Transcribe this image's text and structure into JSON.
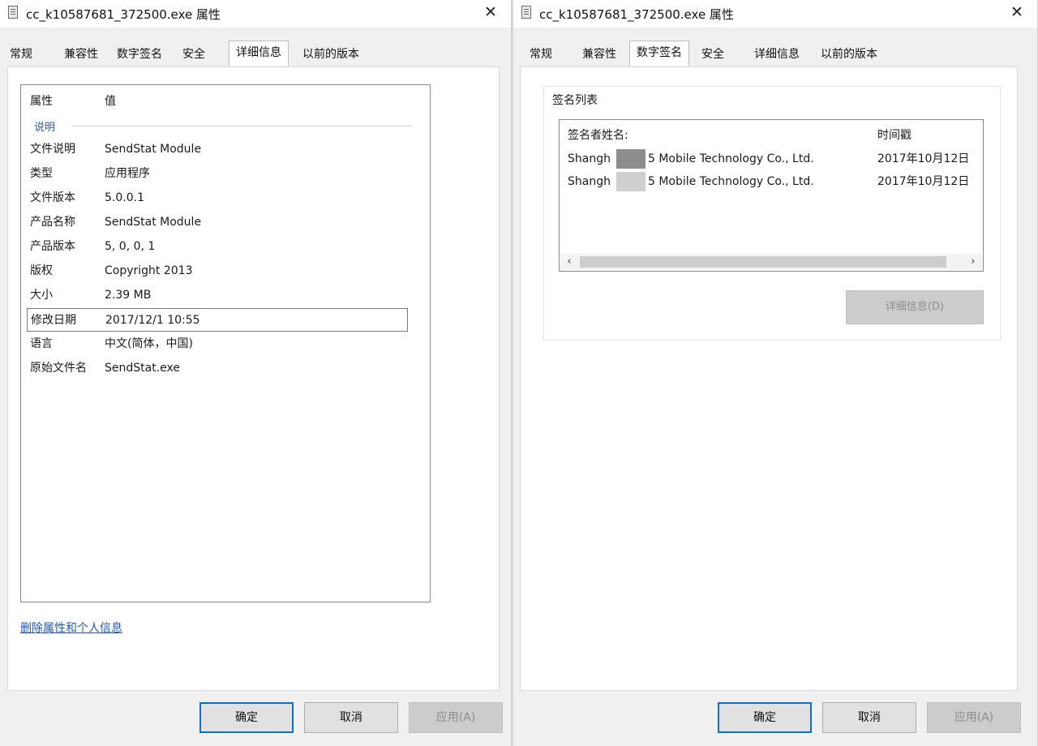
{
  "left_window": {
    "title": "cc_k10587681_372500.exe 属性",
    "tabs": [
      "常规",
      "兼容性",
      "数字签名",
      "安全",
      "详细信息",
      "以前的版本"
    ],
    "active_tab": "详细信息",
    "details": {
      "header_property": "属性",
      "header_value": "值",
      "group": "说明",
      "rows": [
        {
          "key": "文件说明",
          "value": "SendStat Module"
        },
        {
          "key": "类型",
          "value": "应用程序"
        },
        {
          "key": "文件版本",
          "value": "5.0.0.1"
        },
        {
          "key": "产品名称",
          "value": "SendStat Module"
        },
        {
          "key": "产品版本",
          "value": "5, 0, 0, 1"
        },
        {
          "key": "版权",
          "value": "Copyright 2013"
        },
        {
          "key": "大小",
          "value": "2.39 MB"
        },
        {
          "key": "修改日期",
          "value": "2017/12/1 10:55"
        },
        {
          "key": "语言",
          "value": "中文(简体，中国)"
        },
        {
          "key": "原始文件名",
          "value": "SendStat.exe"
        }
      ],
      "selected_row": "修改日期"
    },
    "remove_link": "删除属性和个人信息",
    "buttons": {
      "ok": "确定",
      "cancel": "取消",
      "apply": "应用(A)"
    }
  },
  "right_window": {
    "title": "cc_k10587681_372500.exe 属性",
    "tabs": [
      "常规",
      "兼容性",
      "数字签名",
      "安全",
      "详细信息",
      "以前的版本"
    ],
    "active_tab": "数字签名",
    "signature": {
      "group_label": "签名列表",
      "col_name": "签名者姓名:",
      "col_time": "时间戳",
      "rows": [
        {
          "name_prefix": "Shangh",
          "name_suffix": "5 Mobile Technology Co., Ltd.",
          "time": "2017年10月12日"
        },
        {
          "name_prefix": "Shangh",
          "name_suffix": "5 Mobile Technology Co., Ltd.",
          "time": "2017年10月12日"
        }
      ],
      "details_button": "详细信息(D)"
    },
    "buttons": {
      "ok": "确定",
      "cancel": "取消",
      "apply": "应用(A)"
    }
  },
  "icons": {
    "close": "close-icon",
    "file": "file-icon"
  },
  "colors": {
    "link": "#1f56c7",
    "focus_border": "#0f6fc6"
  }
}
